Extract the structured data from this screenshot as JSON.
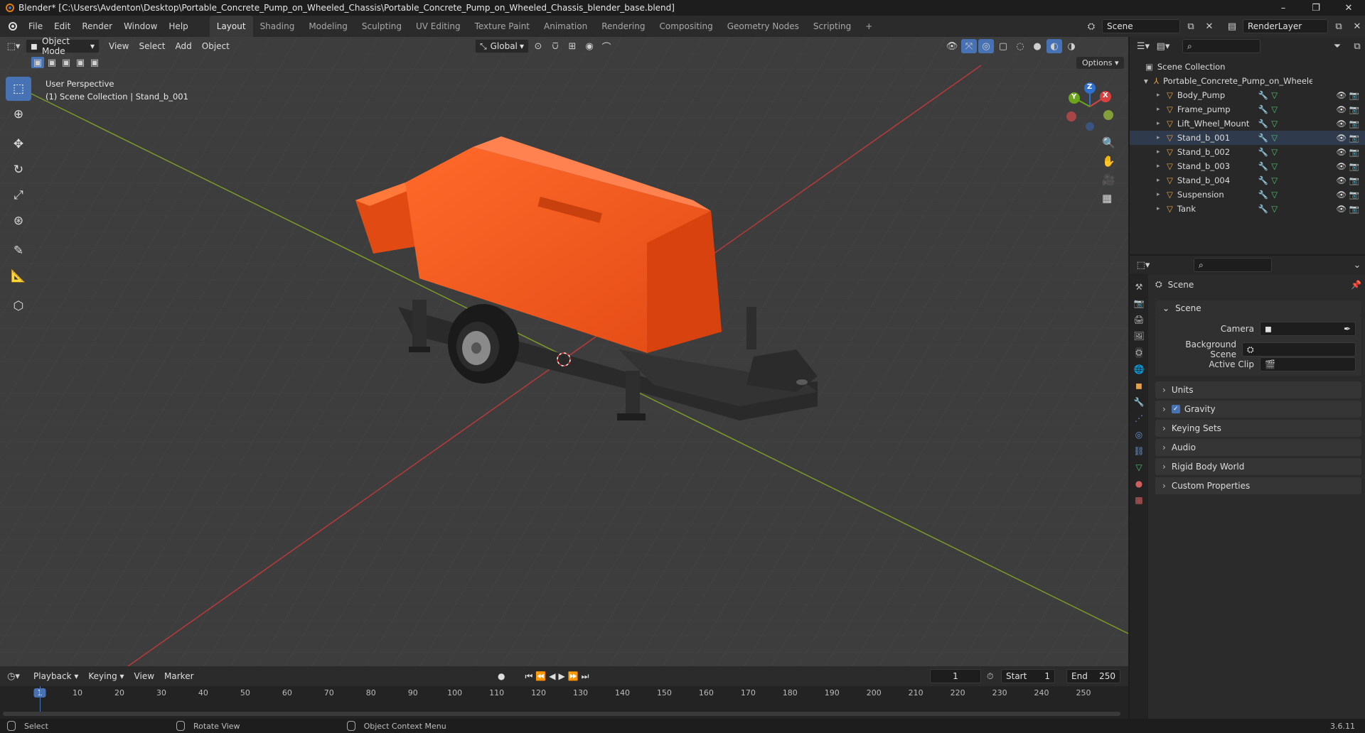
{
  "window": {
    "title": "Blender* [C:\\Users\\Avdenton\\Desktop\\Portable_Concrete_Pump_on_Wheeled_Chassis\\Portable_Concrete_Pump_on_Wheeled_Chassis_blender_base.blend]",
    "minimize": "–",
    "maximize": "❐",
    "close": "✕"
  },
  "menu": {
    "items": [
      "File",
      "Edit",
      "Render",
      "Window",
      "Help"
    ],
    "workspaces": [
      "Layout",
      "Shading",
      "Modeling",
      "Sculpting",
      "UV Editing",
      "Texture Paint",
      "Animation",
      "Rendering",
      "Compositing",
      "Geometry Nodes",
      "Scripting"
    ],
    "add_workspace": "+",
    "scene": "Scene",
    "view_layer": "RenderLayer"
  },
  "viewport": {
    "mode": "Object Mode",
    "menus": [
      "View",
      "Select",
      "Add",
      "Object"
    ],
    "orientation": "Global",
    "options": "Options",
    "info_line1": "User Perspective",
    "info_line2": "(1) Scene Collection | Stand_b_001",
    "gizmo": {
      "x": "X",
      "y": "Y",
      "z": "Z"
    }
  },
  "outliner": {
    "root": "Scene Collection",
    "collection": "Portable_Concrete_Pump_on_Wheeled_C",
    "objects": [
      {
        "name": "Body_Pump",
        "selected": false
      },
      {
        "name": "Frame_pump",
        "selected": false
      },
      {
        "name": "Lift_Wheel_Mount",
        "selected": false
      },
      {
        "name": "Stand_b_001",
        "selected": true
      },
      {
        "name": "Stand_b_002",
        "selected": false
      },
      {
        "name": "Stand_b_003",
        "selected": false
      },
      {
        "name": "Stand_b_004",
        "selected": false
      },
      {
        "name": "Suspension",
        "selected": false
      },
      {
        "name": "Tank",
        "selected": false
      }
    ]
  },
  "properties": {
    "context": "Scene",
    "section": "Scene",
    "fields": [
      {
        "label": "Camera",
        "value": ""
      },
      {
        "label": "Background Scene",
        "value": ""
      },
      {
        "label": "Active Clip",
        "value": ""
      }
    ],
    "panels": [
      "Units",
      "Gravity",
      "Keying Sets",
      "Audio",
      "Rigid Body World",
      "Custom Properties"
    ],
    "gravity_enabled": true
  },
  "timeline": {
    "menus": [
      "Playback",
      "Keying",
      "View",
      "Marker"
    ],
    "current_frame": "1",
    "start_label": "Start",
    "start": "1",
    "end_label": "End",
    "end": "250",
    "ticks": [
      "1",
      "10",
      "20",
      "30",
      "40",
      "50",
      "60",
      "70",
      "80",
      "90",
      "100",
      "110",
      "120",
      "130",
      "140",
      "150",
      "160",
      "170",
      "180",
      "190",
      "200",
      "210",
      "220",
      "230",
      "240",
      "250"
    ]
  },
  "statusbar": {
    "select": "Select",
    "rotate": "Rotate View",
    "context_menu": "Object Context Menu",
    "version": "3.6.11"
  },
  "colors": {
    "accent": "#4772b3",
    "pump_orange": "#f0501a",
    "x_axis": "#b83a3a",
    "y_axis": "#7a9a2a"
  }
}
